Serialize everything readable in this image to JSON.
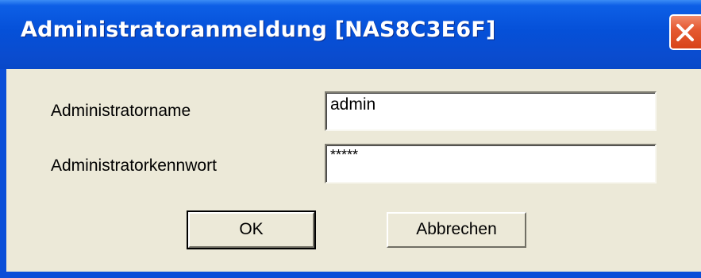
{
  "window": {
    "title": "Administratoranmeldung [NAS8C3E6F]",
    "close_icon": "close-x-icon"
  },
  "form": {
    "username_label": "Administratorname",
    "username_value": "admin",
    "password_label": "Administratorkennwort",
    "password_value": "*****"
  },
  "buttons": {
    "ok_label": "OK",
    "cancel_label": "Abbrechen"
  },
  "colors": {
    "titlebar": "#0550d8",
    "client_background": "#ece9d8",
    "close_button": "#e55a32"
  }
}
